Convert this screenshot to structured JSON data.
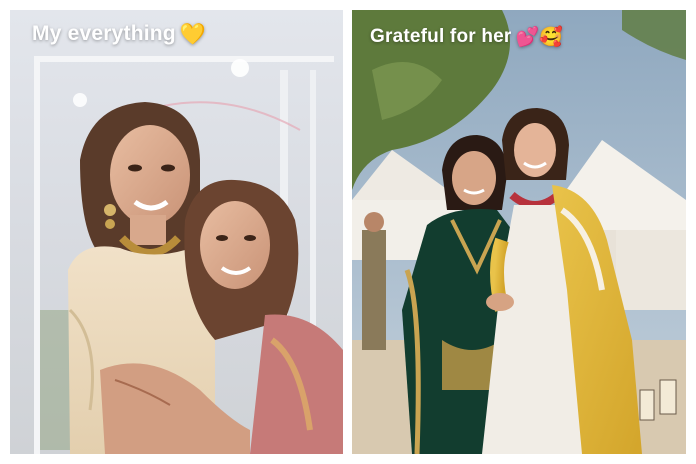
{
  "left_story": {
    "caption": "My everything",
    "caption_emoji": "💛",
    "scene": "two-women-hugging"
  },
  "right_story": {
    "caption": "Grateful for her",
    "caption_emoji": "💕🥰",
    "scene": "two-women-standing-outdoors"
  },
  "colors": {
    "caption_text": "#ffffff",
    "left_background": "#d9dde4",
    "right_sky": "#9fb6c9"
  }
}
